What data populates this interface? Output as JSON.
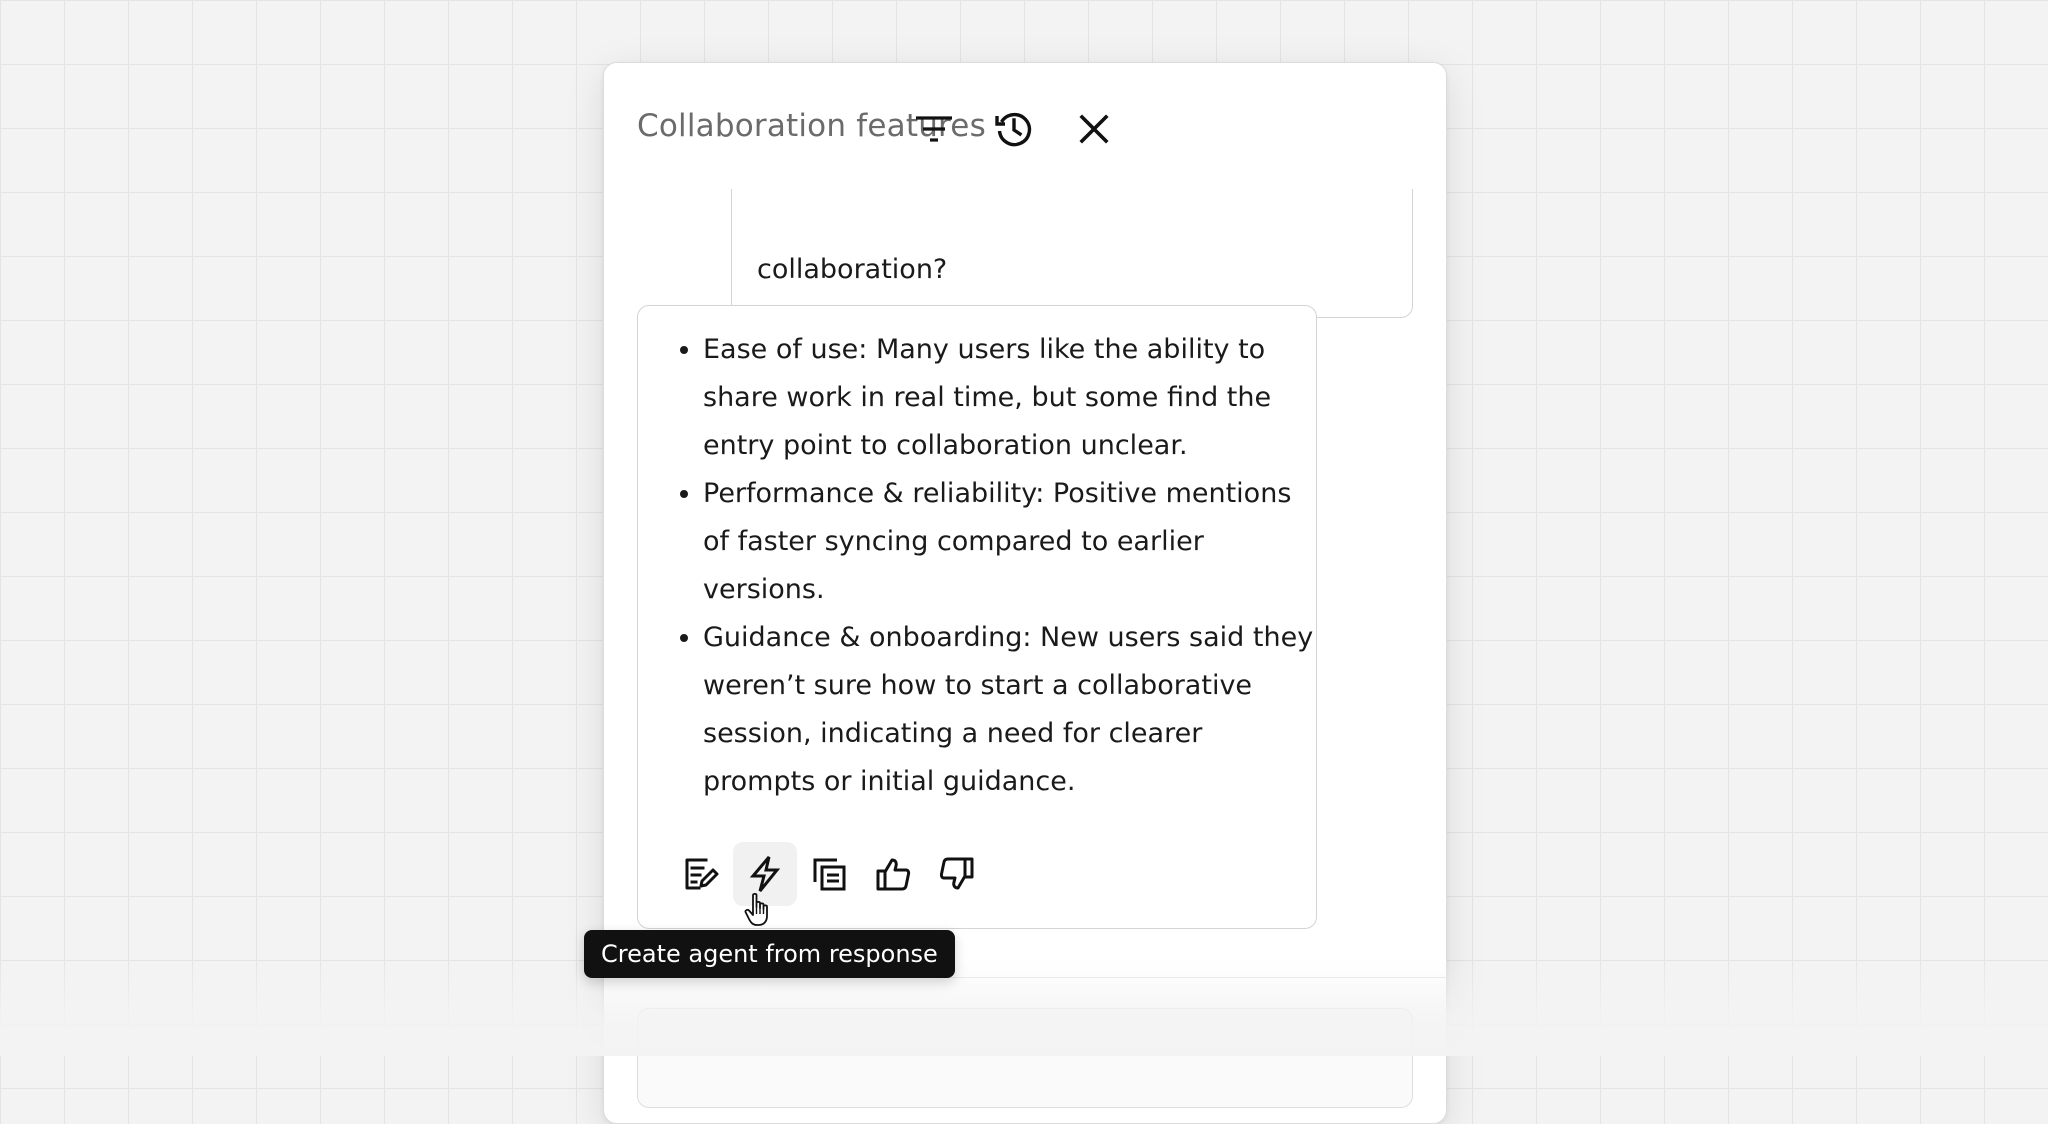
{
  "panel": {
    "title": "Collaboration features"
  },
  "header_buttons": {
    "filter_icon": "filter-icon",
    "history_icon": "history-icon",
    "close_icon": "close-icon"
  },
  "user_message": {
    "visible_text": "collaboration?"
  },
  "response": {
    "items": [
      "Ease of use: Many users like the ability to share work in real time, but some find the entry point to collaboration unclear.",
      "Performance & reliability: Positive mentions of faster syncing compared to earlier versions.",
      "Guidance & onboarding: New users said they weren’t sure how to start a collaborative session, indicating a need for clearer prompts or initial guidance."
    ],
    "actions": [
      {
        "icon": "edit-note-icon"
      },
      {
        "icon": "lightning-icon",
        "hovered": true
      },
      {
        "icon": "copy-icon"
      },
      {
        "icon": "thumbs-up-icon"
      },
      {
        "icon": "thumbs-down-icon"
      }
    ]
  },
  "tooltip": {
    "text": "Create agent from response"
  },
  "colors": {
    "background": "#f3f3f3",
    "grid_line": "#e4e4e4",
    "panel": "#ffffff",
    "tooltip_bg": "#111111",
    "title_text": "#6b6b6b"
  }
}
